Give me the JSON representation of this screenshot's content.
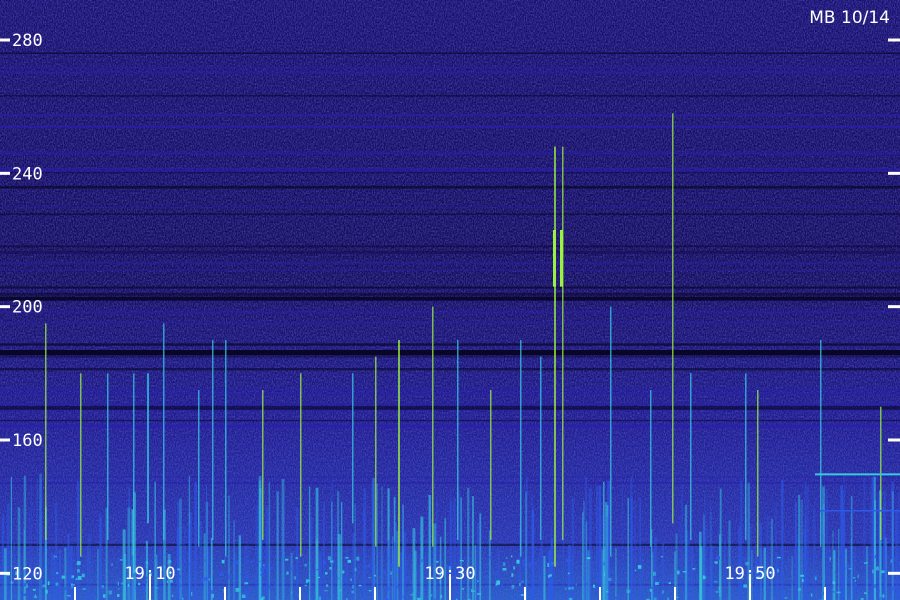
{
  "chart_data": {
    "type": "heatmap",
    "title": "MB 10/14",
    "xlabel": "",
    "ylabel": "",
    "y_ticks": [
      120,
      160,
      200,
      240,
      280
    ],
    "ylim": [
      112,
      292
    ],
    "x_tick_labels": [
      "19:10",
      "19:30",
      "19:50"
    ],
    "x_tick_minutes": [
      10,
      30,
      50
    ],
    "xlim_minutes": [
      0,
      60
    ],
    "colormap": [
      "#0a0830",
      "#2a1fb0",
      "#2d5be8",
      "#35c8e0",
      "#9cf040"
    ],
    "grid": false,
    "legend": "none"
  }
}
